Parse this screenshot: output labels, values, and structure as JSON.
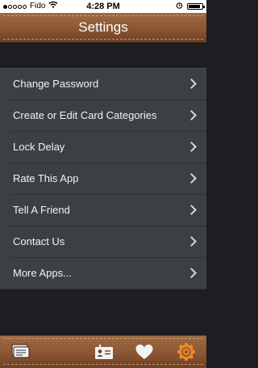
{
  "status_bar": {
    "carrier": "Fido",
    "time": "4:28 PM",
    "signal_bars_filled": 1,
    "signal_bars_total": 5,
    "battery_level": 0.9
  },
  "nav": {
    "title": "Settings"
  },
  "settings": {
    "items": [
      {
        "label": "Change Password"
      },
      {
        "label": "Create or Edit Card Categories"
      },
      {
        "label": "Lock Delay"
      },
      {
        "label": "Rate This App"
      },
      {
        "label": "Tell A Friend"
      },
      {
        "label": "Contact Us"
      },
      {
        "label": "More Apps..."
      }
    ]
  },
  "tab_bar": {
    "tabs": [
      {
        "icon": "cards-icon"
      },
      {
        "icon": "id-card-icon"
      },
      {
        "icon": "heart-icon"
      },
      {
        "icon": "gear-icon",
        "active": true
      }
    ],
    "active_color": "#f08a24"
  },
  "colors": {
    "leather": "#8a5634",
    "background": "#1c1e21",
    "list_background": "#3c4045"
  }
}
